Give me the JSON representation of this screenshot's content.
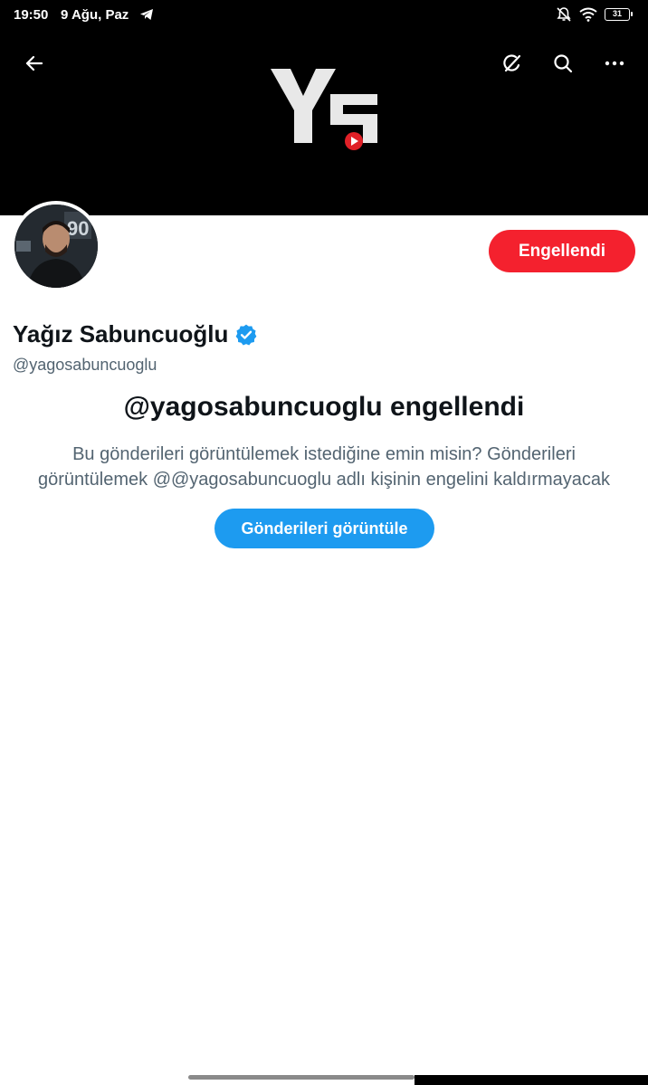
{
  "status_bar": {
    "time": "19:50",
    "date": "9 Ağu, Paz",
    "battery": "31"
  },
  "header": {
    "back_icon": "arrow-left-icon",
    "grok_icon": "grok-icon",
    "search_icon": "search-icon",
    "more_icon": "more-dots-icon",
    "banner_logo_text": "YS"
  },
  "profile": {
    "display_name": "Yağız Sabuncuoğlu",
    "handle": "@yagosabuncuoglu",
    "verified": true,
    "blocked_button_label": "Engellendi"
  },
  "blocked_notice": {
    "title": "@yagosabuncuoglu engellendi",
    "description": "Bu gönderileri görüntülemek istediğine emin misin? Gönderileri görüntülemek @@yagosabuncuoglu adlı kişinin engelini kaldırmayacak",
    "view_button_label": "Gönderileri görüntüle"
  },
  "colors": {
    "banner_bg": "#000000",
    "blocked_red": "#f4212e",
    "primary_blue": "#1d9bf0",
    "verified_blue": "#1d9bf0",
    "secondary_text": "#536471"
  }
}
